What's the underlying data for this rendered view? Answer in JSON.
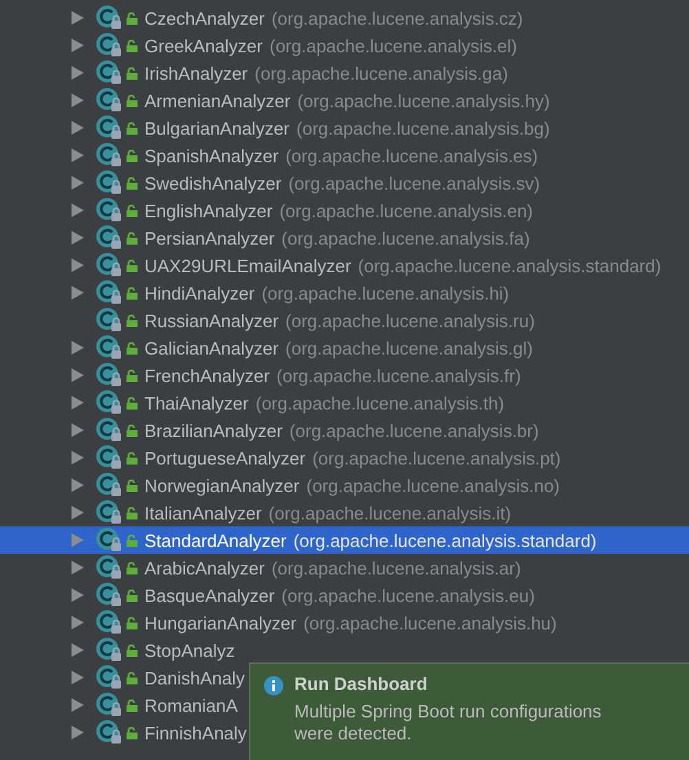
{
  "tree": {
    "items": [
      {
        "name": "CzechAnalyzer",
        "package": "(org.apache.lucene.analysis.cz)",
        "expandable": true,
        "selected": false
      },
      {
        "name": "GreekAnalyzer",
        "package": "(org.apache.lucene.analysis.el)",
        "expandable": true,
        "selected": false
      },
      {
        "name": "IrishAnalyzer",
        "package": "(org.apache.lucene.analysis.ga)",
        "expandable": true,
        "selected": false
      },
      {
        "name": "ArmenianAnalyzer",
        "package": "(org.apache.lucene.analysis.hy)",
        "expandable": true,
        "selected": false
      },
      {
        "name": "BulgarianAnalyzer",
        "package": "(org.apache.lucene.analysis.bg)",
        "expandable": true,
        "selected": false
      },
      {
        "name": "SpanishAnalyzer",
        "package": "(org.apache.lucene.analysis.es)",
        "expandable": true,
        "selected": false
      },
      {
        "name": "SwedishAnalyzer",
        "package": "(org.apache.lucene.analysis.sv)",
        "expandable": true,
        "selected": false
      },
      {
        "name": "EnglishAnalyzer",
        "package": "(org.apache.lucene.analysis.en)",
        "expandable": true,
        "selected": false
      },
      {
        "name": "PersianAnalyzer",
        "package": "(org.apache.lucene.analysis.fa)",
        "expandable": true,
        "selected": false
      },
      {
        "name": "UAX29URLEmailAnalyzer",
        "package": "(org.apache.lucene.analysis.standard)",
        "expandable": true,
        "selected": false
      },
      {
        "name": "HindiAnalyzer",
        "package": "(org.apache.lucene.analysis.hi)",
        "expandable": true,
        "selected": false
      },
      {
        "name": "RussianAnalyzer",
        "package": "(org.apache.lucene.analysis.ru)",
        "expandable": false,
        "selected": false
      },
      {
        "name": "GalicianAnalyzer",
        "package": "(org.apache.lucene.analysis.gl)",
        "expandable": true,
        "selected": false
      },
      {
        "name": "FrenchAnalyzer",
        "package": "(org.apache.lucene.analysis.fr)",
        "expandable": true,
        "selected": false
      },
      {
        "name": "ThaiAnalyzer",
        "package": "(org.apache.lucene.analysis.th)",
        "expandable": true,
        "selected": false
      },
      {
        "name": "BrazilianAnalyzer",
        "package": "(org.apache.lucene.analysis.br)",
        "expandable": true,
        "selected": false
      },
      {
        "name": "PortugueseAnalyzer",
        "package": "(org.apache.lucene.analysis.pt)",
        "expandable": true,
        "selected": false
      },
      {
        "name": "NorwegianAnalyzer",
        "package": "(org.apache.lucene.analysis.no)",
        "expandable": true,
        "selected": false
      },
      {
        "name": "ItalianAnalyzer",
        "package": "(org.apache.lucene.analysis.it)",
        "expandable": true,
        "selected": false
      },
      {
        "name": "StandardAnalyzer",
        "package": "(org.apache.lucene.analysis.standard)",
        "expandable": true,
        "selected": true
      },
      {
        "name": "ArabicAnalyzer",
        "package": "(org.apache.lucene.analysis.ar)",
        "expandable": true,
        "selected": false
      },
      {
        "name": "BasqueAnalyzer",
        "package": "(org.apache.lucene.analysis.eu)",
        "expandable": true,
        "selected": false
      },
      {
        "name": "HungarianAnalyzer",
        "package": "(org.apache.lucene.analysis.hu)",
        "expandable": true,
        "selected": false
      },
      {
        "name": "StopAnalyz",
        "expandable": true,
        "selected": false
      },
      {
        "name": "DanishAnaly",
        "expandable": true,
        "selected": false
      },
      {
        "name": "RomanianA",
        "expandable": true,
        "selected": false
      },
      {
        "name": "FinnishAnaly",
        "expandable": true,
        "selected": false
      }
    ]
  },
  "notification": {
    "title": "Run Dashboard",
    "message": "Multiple Spring Boot run configurations were detected."
  }
}
